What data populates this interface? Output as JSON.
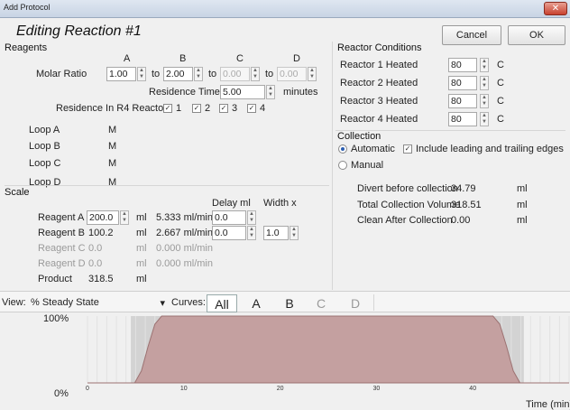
{
  "window": {
    "title": "Add Protocol",
    "close_glyph": "✕"
  },
  "heading": "Editing Reaction #1",
  "buttons": {
    "cancel": "Cancel",
    "ok": "OK"
  },
  "reagents": {
    "title": "Reagents",
    "col_a": "A",
    "col_b": "B",
    "col_c": "C",
    "col_d": "D",
    "molar_ratio_label": "Molar Ratio",
    "molar_a": "1.00",
    "molar_b": "2.00",
    "molar_c": "0.00",
    "molar_d": "0.00",
    "to": "to",
    "residence_time_label": "Residence Time",
    "residence_time_value": "5.00",
    "residence_time_unit": "minutes",
    "residence_r4_label": "Residence In R4 Reactors",
    "r4_checks": [
      "1",
      "2",
      "3",
      "4"
    ],
    "loops": [
      {
        "label": "Loop A",
        "value": "M"
      },
      {
        "label": "Loop B",
        "value": "M"
      },
      {
        "label": "Loop C",
        "value": "M"
      },
      {
        "label": "Loop D",
        "value": "M"
      }
    ]
  },
  "scale": {
    "title": "Scale",
    "delay_header": "Delay ml",
    "width_header": "Width x",
    "rows": [
      {
        "label": "Reagent A",
        "value": "200.0",
        "unit": "ml",
        "rate": "5.333 ml/min",
        "delay": "0.0",
        "width": ""
      },
      {
        "label": "Reagent B",
        "value": "100.2",
        "unit": "ml",
        "rate": "2.667 ml/min",
        "delay": "0.0",
        "width": "1.0"
      },
      {
        "label": "Reagent C",
        "value": "0.0",
        "unit": "ml",
        "rate": "0.000 ml/min"
      },
      {
        "label": "Reagent D",
        "value": "0.0",
        "unit": "ml",
        "rate": "0.000 ml/min"
      },
      {
        "label": "Product",
        "value": "318.5",
        "unit": "ml"
      }
    ]
  },
  "reactor": {
    "title": "Reactor Conditions",
    "unit": "C",
    "items": [
      {
        "label": "Reactor 1 Heated",
        "value": "80"
      },
      {
        "label": "Reactor 2 Heated",
        "value": "80"
      },
      {
        "label": "Reactor 3 Heated",
        "value": "80"
      },
      {
        "label": "Reactor 4 Heated",
        "value": "80"
      }
    ]
  },
  "collection": {
    "title": "Collection",
    "automatic": "Automatic",
    "include_edges": "Include leading and trailing edges",
    "manual": "Manual",
    "stats": [
      {
        "label": "Divert before collection",
        "value": "34.79",
        "unit": "ml"
      },
      {
        "label": "Total Collection Volume",
        "value": "318.51",
        "unit": "ml"
      },
      {
        "label": "Clean After Collection",
        "value": "0.00",
        "unit": "ml"
      }
    ]
  },
  "viewbar": {
    "view_label": "View:",
    "view_value": "% Steady State",
    "curves_label": "Curves:",
    "curves": [
      "All",
      "A",
      "B",
      "C",
      "D"
    ]
  },
  "colors": {
    "fill": "#c4a0a0",
    "fill_stroke": "#9c7272",
    "steady_band": "#d3d3d3"
  },
  "chart_data": {
    "type": "area",
    "ylabel_top": "100%",
    "ylabel_bottom": "0%",
    "xlabel": "Time (min)",
    "x_ticks": [
      "0",
      "10",
      "20",
      "30",
      "40"
    ],
    "xlim": [
      0,
      50
    ],
    "ylim": [
      0,
      100
    ],
    "x": [
      0,
      4.9,
      5.6,
      6.3,
      7.0,
      7.7,
      42.1,
      42.8,
      43.5,
      44.2,
      44.9,
      50
    ],
    "y": [
      0,
      0,
      18,
      55,
      88,
      100,
      100,
      88,
      55,
      18,
      0,
      0
    ],
    "steady_band": [
      [
        4.5,
        7.9
      ],
      [
        41.9,
        45.3
      ]
    ]
  }
}
